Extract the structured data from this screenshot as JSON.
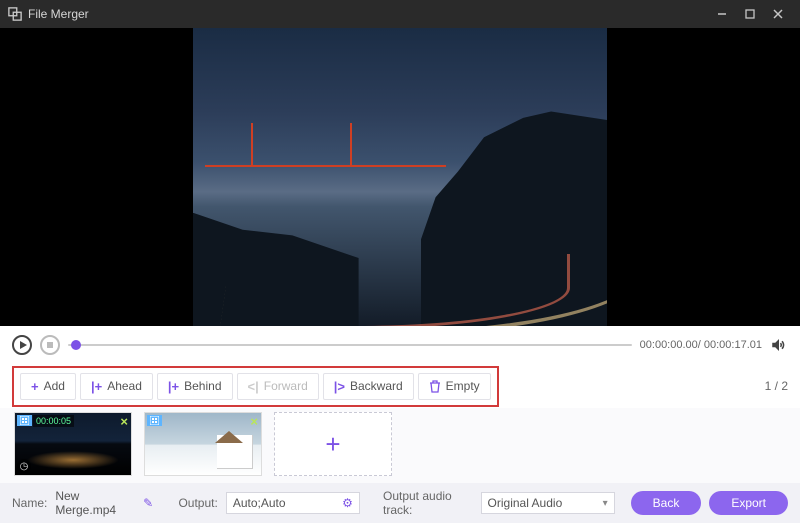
{
  "titlebar": {
    "title": "File Merger"
  },
  "player": {
    "current_time": "00:00:00.00",
    "total_time": "00:00:17.01",
    "time_display": "00:00:00.00/ 00:00:17.01"
  },
  "toolbar": {
    "add": "Add",
    "ahead": "Ahead",
    "behind": "Behind",
    "forward": "Forward",
    "backward": "Backward",
    "empty": "Empty"
  },
  "pager": {
    "text": "1 / 2"
  },
  "clips": [
    {
      "duration": "00:00:05"
    },
    {
      "duration": ""
    }
  ],
  "footer": {
    "name_label": "Name:",
    "name_value": "New Merge.mp4",
    "output_label": "Output:",
    "output_value": "Auto;Auto",
    "audio_label": "Output audio track:",
    "audio_value": "Original Audio",
    "back": "Back",
    "export": "Export"
  }
}
